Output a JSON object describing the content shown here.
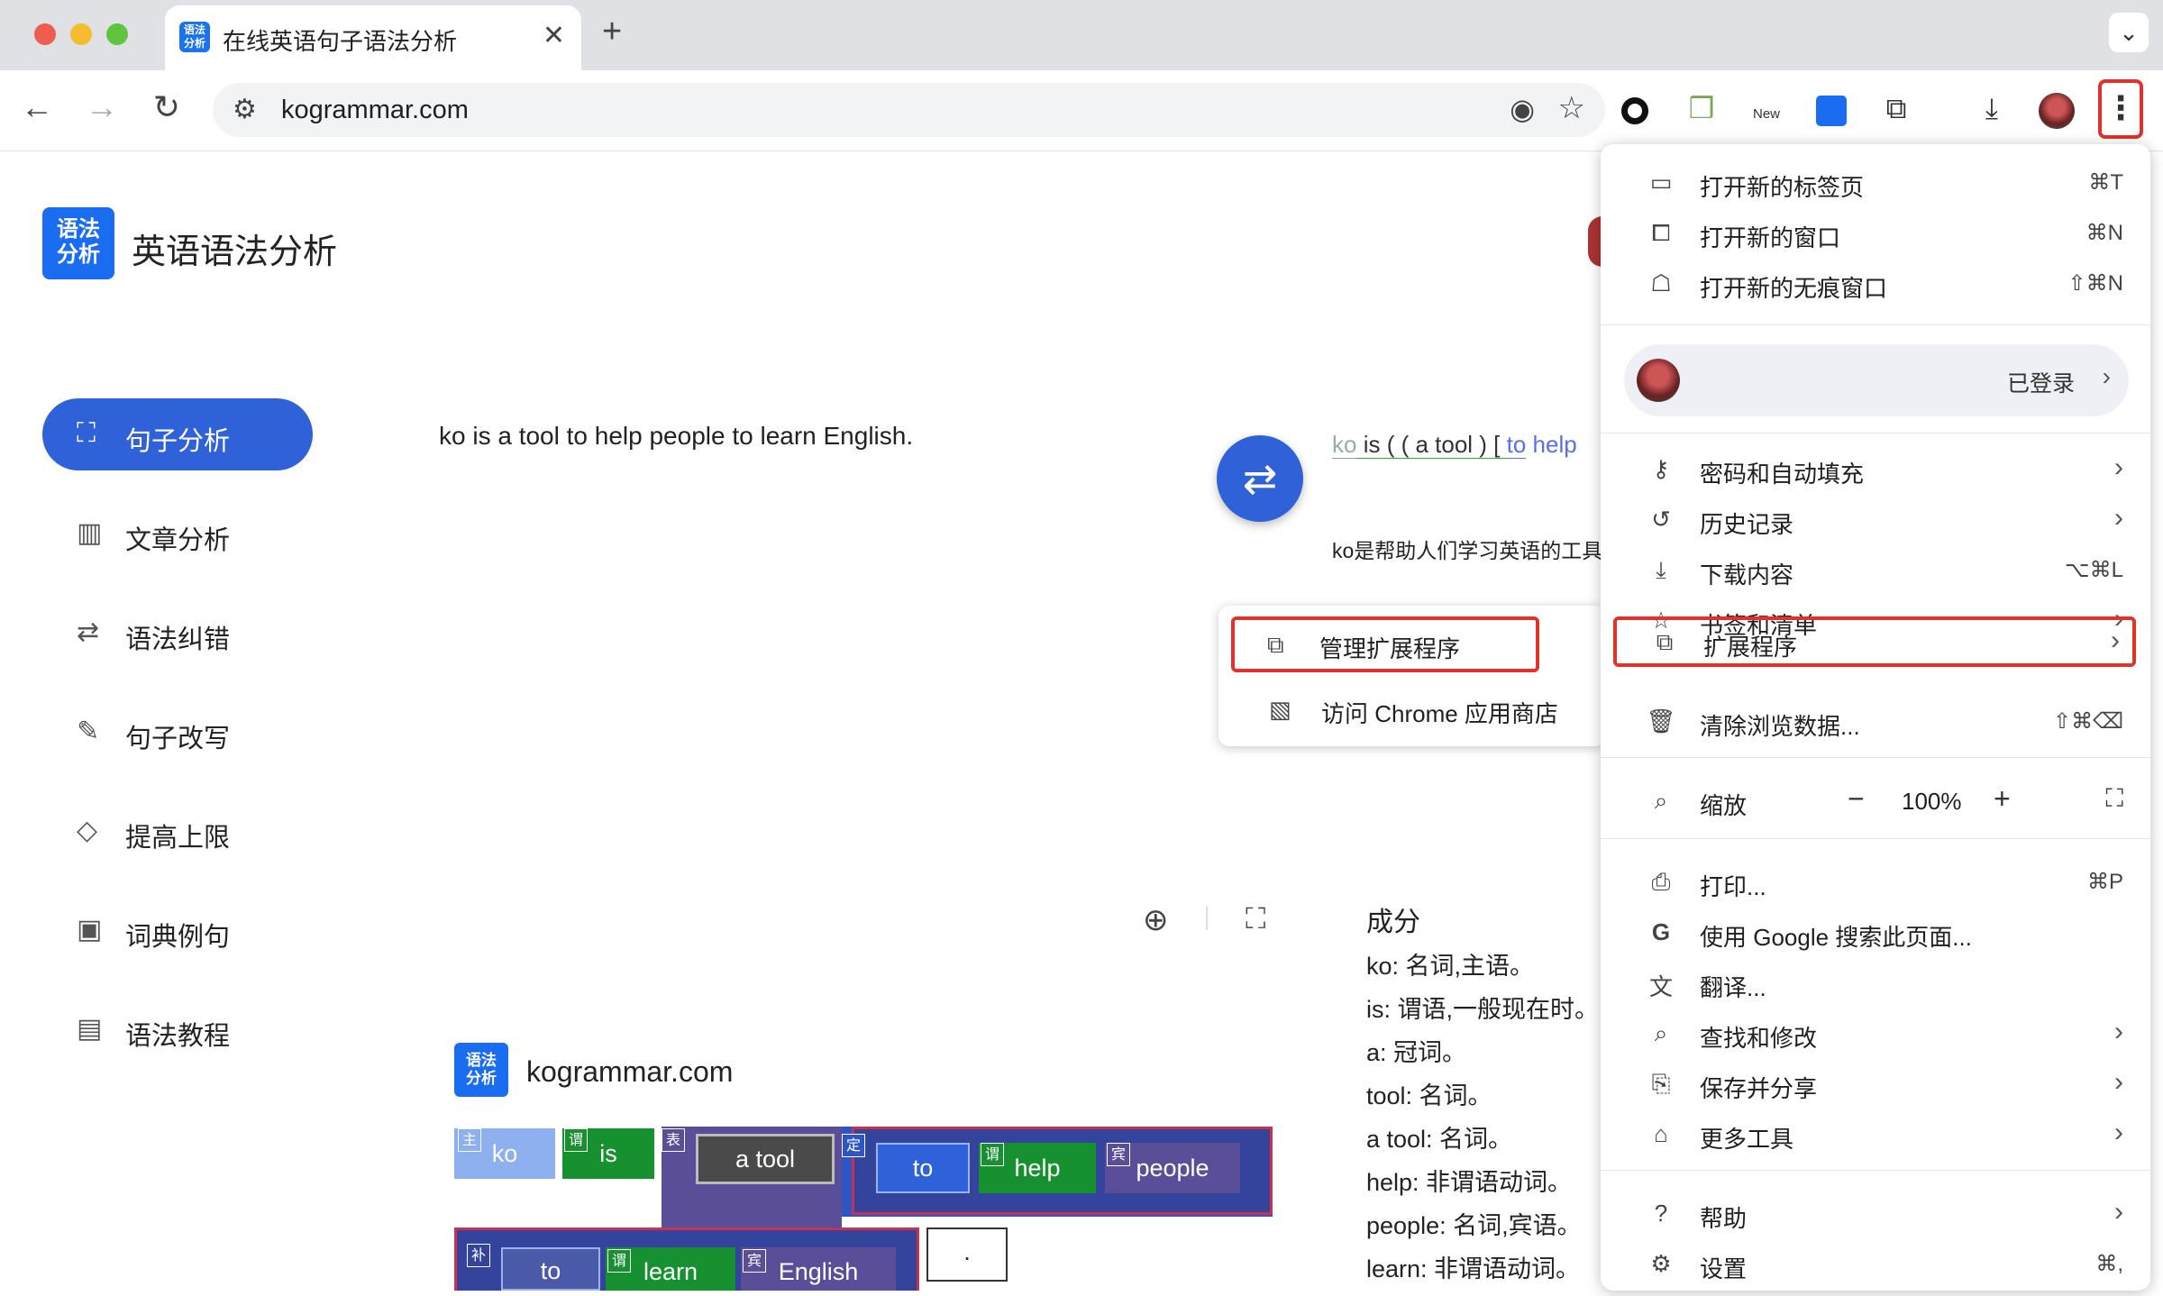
{
  "browser": {
    "tab_title": "在线英语句子语法分析",
    "tab_favicon_text": "语法\n分析",
    "url": "kogrammar.com",
    "new_badge": "New"
  },
  "site": {
    "logo_text": "语法\n分析",
    "title": "英语语法分析"
  },
  "sidebar": {
    "items": [
      {
        "icon": "sentence-analysis-icon",
        "label": "句子分析"
      },
      {
        "icon": "book-icon",
        "label": "文章分析"
      },
      {
        "icon": "correction-icon",
        "label": "语法纠错"
      },
      {
        "icon": "rewrite-icon",
        "label": "句子改写"
      },
      {
        "icon": "diamond-icon",
        "label": "提高上限"
      },
      {
        "icon": "dictionary-icon",
        "label": "词典例句"
      },
      {
        "icon": "tutorial-icon",
        "label": "语法教程"
      }
    ]
  },
  "main": {
    "input_sentence": "ko is a tool to help people to learn English.",
    "parse_ko": "ko",
    "parse_is": " is ( ( a tool ) [ ",
    "parse_to": "to",
    "parse_help": " help",
    "translation": "ko是帮助人们学习英语的工具",
    "components_title": "成分",
    "components": [
      "ko: 名词,主语。",
      "is: 谓语,一般现在时。",
      "a: 冠词。",
      "tool: 名词。",
      "a tool: 名词。",
      "help: 非谓语动词。",
      "people: 名词,宾语。",
      "learn: 非谓语动词。"
    ]
  },
  "diagram": {
    "domain": "kogrammar.com",
    "row1": [
      {
        "tag": "主",
        "word": "ko"
      },
      {
        "tag": "谓",
        "word": "is"
      },
      {
        "tag": "表",
        "word": "a tool"
      },
      {
        "tag": "定",
        "word": "to"
      },
      {
        "tag": "谓",
        "word": "help"
      },
      {
        "tag": "宾",
        "word": "people"
      }
    ],
    "row2": [
      {
        "tag": "补",
        "word": "to"
      },
      {
        "tag": "谓",
        "word": "learn"
      },
      {
        "tag": "宾",
        "word": "English"
      }
    ],
    "period": "."
  },
  "extensions_submenu": {
    "manage": "管理扩展程序",
    "store": "访问 Chrome 应用商店"
  },
  "chrome_menu": {
    "new_tab": {
      "label": "打开新的标签页",
      "shortcut": "⌘T"
    },
    "new_window": {
      "label": "打开新的窗口",
      "shortcut": "⌘N"
    },
    "incognito": {
      "label": "打开新的无痕窗口",
      "shortcut": "⇧⌘N"
    },
    "profile_status": "已登录",
    "passwords": {
      "label": "密码和自动填充"
    },
    "history": {
      "label": "历史记录"
    },
    "downloads": {
      "label": "下载内容",
      "shortcut": "⌥⌘L"
    },
    "bookmarks": {
      "label": "书签和清单"
    },
    "extensions": {
      "label": "扩展程序"
    },
    "clear_data": {
      "label": "清除浏览数据...",
      "shortcut": "⇧⌘⌫"
    },
    "zoom": {
      "label": "缩放",
      "minus": "−",
      "value": "100%",
      "plus": "+"
    },
    "print": {
      "label": "打印...",
      "shortcut": "⌘P"
    },
    "google_search": {
      "label": "使用 Google 搜索此页面..."
    },
    "translate": {
      "label": "翻译..."
    },
    "find": {
      "label": "查找和修改"
    },
    "save_share": {
      "label": "保存并分享"
    },
    "more_tools": {
      "label": "更多工具"
    },
    "help": {
      "label": "帮助"
    },
    "settings": {
      "label": "设置",
      "shortcut": "⌘,"
    }
  }
}
